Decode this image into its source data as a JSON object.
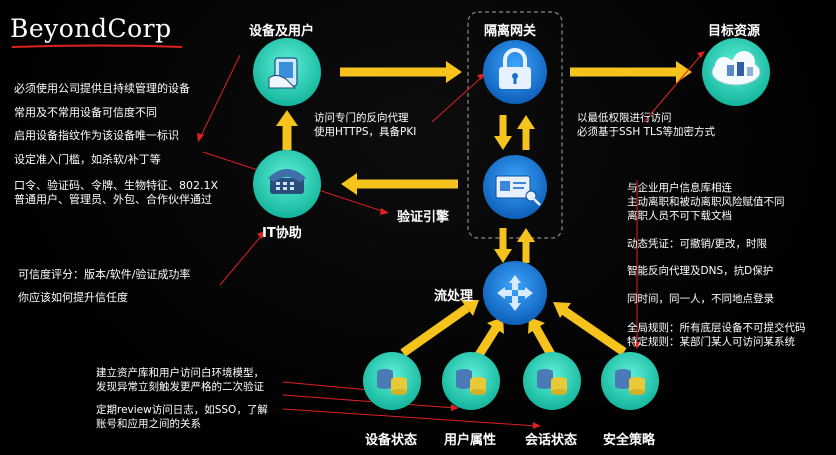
{
  "title": "BeyondCorp",
  "nodes": {
    "devices_users": "设备及用户",
    "isolation_gateway": "隔离网关",
    "target_resources": "目标资源",
    "it_assist": "IT协助",
    "auth_engine": "验证引擎",
    "stream_processing": "流处理",
    "device_state": "设备状态",
    "user_attributes": "用户属性",
    "session_state": "会话状态",
    "security_policy": "安全策略"
  },
  "notes": {
    "device_requirements": [
      "必须使用公司提供且持续管理的设备",
      "常用及不常用设备可信度不同",
      "启用设备指纹作为该设备唯一标识",
      "设定准入门槛，如杀软/补丁等"
    ],
    "auth_methods": [
      "口令、验证码、令牌、生物特征、802.1X",
      "普通用户、管理员、外包、合作伙伴通过"
    ],
    "trust_score": [
      "可信度评分：版本/软件/验证成功率",
      "你应该如何提升信任度"
    ],
    "reverse_proxy": [
      "访问专门的反向代理",
      "使用HTTPS，具备PKI"
    ],
    "least_privilege": [
      "以最低权限进行访问",
      "必须基于SSH TLS等加密方式"
    ],
    "policy_notes": [
      "与企业用户信息库相连",
      "主动离职和被动离职风险赋值不同",
      "离职人员不可下载文档"
    ],
    "dynamic_cred": "动态凭证：可撤销/更改，时限",
    "smart_proxy": "智能反向代理及DNS，抗D保护",
    "same_time": "同时间，同一人，不同地点登录",
    "rules": [
      "全局规则：所有底层设备不可提交代码",
      "特定规则：某部门某人可访问某系统"
    ],
    "whitelist": [
      "建立资产库和用户访问白环境模型，",
      "发现异常立刻触发更严格的二次验证"
    ],
    "review_logs": [
      "定期review访问日志，如SSO，了解",
      "账号和应用之间的关系"
    ]
  },
  "colors": {
    "arrow": "#f5c31c",
    "node": "#1fc8b0",
    "blue": "#1e7bd6",
    "red": "#e02020"
  },
  "icons": {
    "devices_users": "device-user-icon",
    "target_resources": "cloud-server-icon",
    "it_assist": "telephone-icon",
    "isolation_gateway": "lock-icon",
    "auth_engine": "credential-card-icon",
    "stream_processing": "arrows-cross-icon",
    "data_sources": "database-icon"
  }
}
